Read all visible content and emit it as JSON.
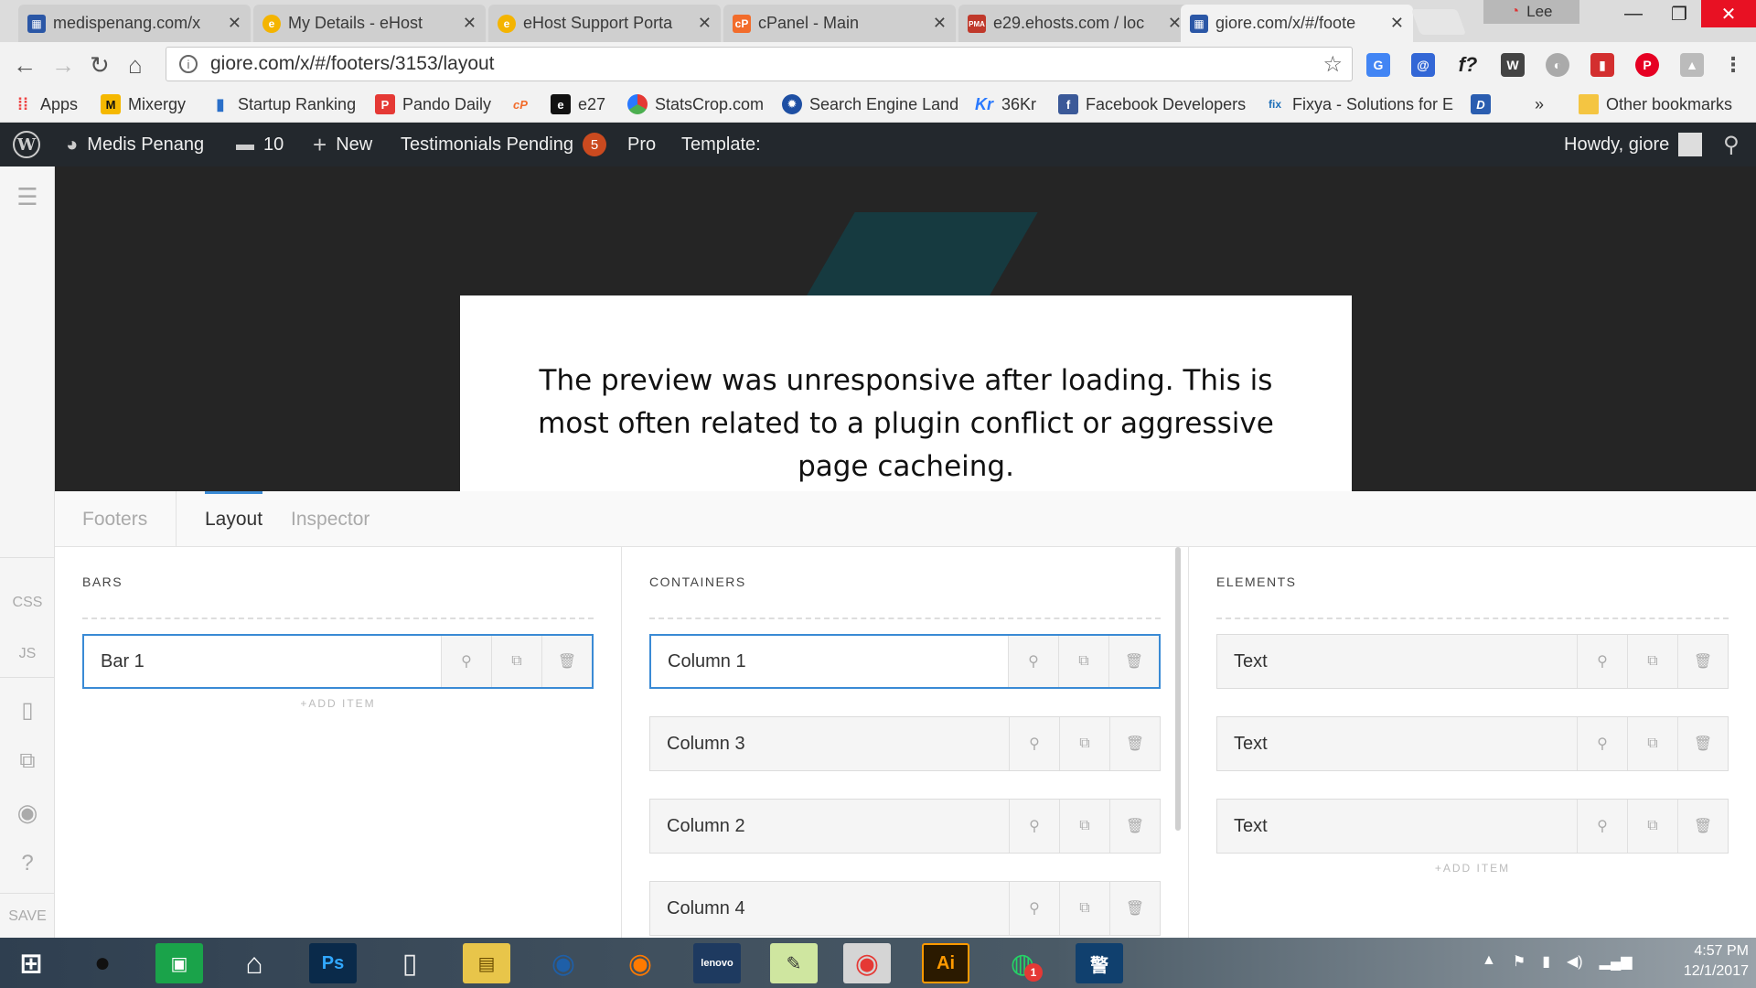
{
  "browser": {
    "tabs": [
      {
        "title": "medispenang.com/x",
        "favicon_color": "#2b57a6"
      },
      {
        "title": "My Details - eHost",
        "favicon_color": "#f4b400"
      },
      {
        "title": "eHost Support Porta",
        "favicon_color": "#f4b400"
      },
      {
        "title": "cPanel - Main",
        "favicon_color": "#f26c2b",
        "favicon_text": "cP"
      },
      {
        "title": "e29.ehosts.com / loc",
        "favicon_color": "#c0392b",
        "favicon_text": "PMA"
      },
      {
        "title": "giore.com/x/#/foote",
        "favicon_color": "#2b57a6",
        "active": true
      }
    ],
    "profile_name": "Lee",
    "url": "giore.com/x/#/footers/3153/layout",
    "bookmarks": [
      {
        "label": "Apps",
        "icon_color": "#e44"
      },
      {
        "label": "Mixergy",
        "icon_text": "M",
        "icon_color": "#f5b800"
      },
      {
        "label": "Startup Ranking",
        "icon_color": "#2a6fc9"
      },
      {
        "label": "Pando Daily",
        "icon_text": "P",
        "icon_color": "#e53935"
      },
      {
        "label": "",
        "icon_text": "cP",
        "icon_color": "#f26c2b"
      },
      {
        "label": "e27",
        "icon_text": "e",
        "icon_color": "#111"
      },
      {
        "label": "StatsCrop.com",
        "icon_color": "#4caf50"
      },
      {
        "label": "Search Engine Land",
        "icon_color": "#1e4fa3"
      },
      {
        "label": "36Kr",
        "icon_text": "Kr",
        "icon_color": "#2979ff"
      },
      {
        "label": "Facebook Developers",
        "icon_text": "f",
        "icon_color": "#3b5998"
      },
      {
        "label": "Fixya - Solutions for E",
        "icon_text": "fix",
        "icon_color": "#1e6fb8"
      },
      {
        "label": "",
        "icon_text": "D",
        "icon_color": "#2a5db0"
      }
    ],
    "bookmarks_overflow": "»",
    "other_bookmarks": "Other bookmarks"
  },
  "wp_admin_bar": {
    "site_name": "Medis Penang",
    "comments_count": "10",
    "new_label": "New",
    "testimonials_label": "Testimonials Pending",
    "testimonials_count": "5",
    "pro_label": "Pro",
    "template_label": "Template:",
    "howdy": "Howdy, giore"
  },
  "left_rail": {
    "css_label": "CSS",
    "js_label": "JS",
    "save_label": "SAVE"
  },
  "preview": {
    "message": "The preview was unresponsive after loading. This is most often related to a plugin conflict or aggressive page cacheing."
  },
  "builder": {
    "tabs": [
      "Footers",
      "Layout",
      "Inspector"
    ],
    "active_tab": "Layout",
    "columns": [
      {
        "heading": "BARS",
        "items": [
          "Bar 1"
        ],
        "add_label": "+ADD ITEM"
      },
      {
        "heading": "CONTAINERS",
        "items": [
          "Column 1",
          "Column 3",
          "Column 2",
          "Column 4"
        ],
        "add_label": ""
      },
      {
        "heading": "ELEMENTS",
        "items": [
          "Text",
          "Text",
          "Text"
        ],
        "add_label": "+ADD ITEM"
      }
    ]
  },
  "taskbar": {
    "time": "4:57 PM",
    "date": "12/1/2017",
    "whatsapp_badge": "1"
  }
}
